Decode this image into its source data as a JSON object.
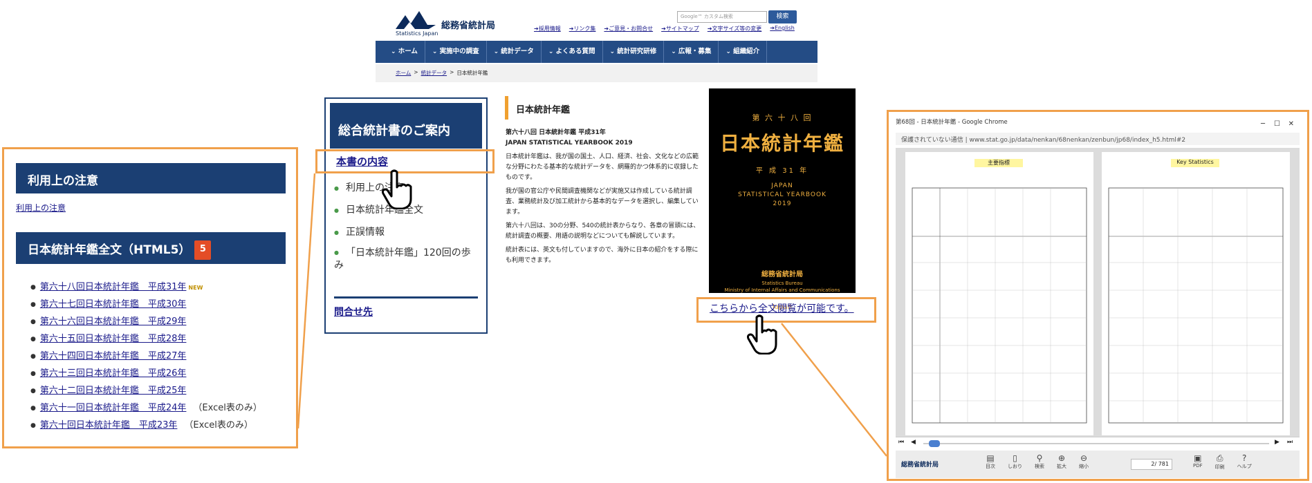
{
  "site": {
    "logo_jp": "総務省統計局",
    "logo_en": "Statistics Japan",
    "search_placeholder": "Google™ カスタム検索",
    "search_button": "検索",
    "top_links": [
      "➔採用情報",
      "➔リンク集",
      "➔ご意見・お問合せ",
      "➔サイトマップ",
      "➔文字サイズ等の変更",
      "➔English"
    ],
    "nav": [
      "ホーム",
      "実施中の調査",
      "統計データ",
      "よくある質問",
      "統計研究研修",
      "広報・募集",
      "組織紹介"
    ],
    "breadcrumb": [
      "ホーム",
      "統計データ",
      "日本統計年鑑"
    ]
  },
  "sidebar": {
    "heading": "総合統計書のご案内",
    "toc_link": "本書の内容",
    "items": [
      "利用上の注意",
      "日本統計年鑑全文",
      "正誤情報",
      "「日本統計年鑑」120回の歩み"
    ],
    "contact": "問合せ先"
  },
  "content": {
    "title": "日本統計年鑑",
    "subtitle_jp": "第六十八回 日本統計年鑑 平成31年",
    "subtitle_en": "JAPAN STATISTICAL YEARBOOK 2019",
    "para1": "日本統計年鑑は、我が国の国土、人口、経済、社会、文化などの広範な分野にわたる基本的な統計データを、網羅的かつ体系的に収録したものです。",
    "para2": "我が国の官公庁や民間調査機関などが実施又は作成している統計調査、業務統計及び加工統計から基本的なデータを選択し、編集しています。",
    "para3": "第六十八回は、30の分野、540の統計表からなり、各章の冒頭には、統計調査の概要、用語の説明などについても解説しています。",
    "para4": "統計表には、英文も付していますので、海外に日本の紹介をする際にも利用できます。"
  },
  "cover": {
    "edition": "第 六 十 八 回",
    "title": "日本統計年鑑",
    "year": "平 成 31 年",
    "en1": "JAPAN",
    "en2": "STATISTICAL YEARBOOK",
    "en3": "2019",
    "bureau_jp": "総務省統計局",
    "bureau_en": "Statistics Bureau",
    "ministry_en": "Ministry of Internal Affairs and Communications",
    "country": "Japan"
  },
  "full_text_link": "こちらから全文閲覧が可能です。",
  "left_panel": {
    "notes_heading": "利用上の注意",
    "notes_link": "利用上の注意",
    "full_heading": "日本統計年鑑全文（HTML5）",
    "html5_badge": "5",
    "editions": [
      {
        "label": "第六十八回日本統計年鑑　平成31年",
        "suffix": "",
        "new": "NEW"
      },
      {
        "label": "第六十七回日本統計年鑑　平成30年",
        "suffix": "",
        "new": ""
      },
      {
        "label": "第六十六回日本統計年鑑　平成29年",
        "suffix": "",
        "new": ""
      },
      {
        "label": "第六十五回日本統計年鑑　平成28年",
        "suffix": "",
        "new": ""
      },
      {
        "label": "第六十四回日本統計年鑑　平成27年",
        "suffix": "",
        "new": ""
      },
      {
        "label": "第六十三回日本統計年鑑　平成26年",
        "suffix": "",
        "new": ""
      },
      {
        "label": "第六十二回日本統計年鑑　平成25年",
        "suffix": "",
        "new": ""
      },
      {
        "label": "第六十一回日本統計年鑑　平成24年",
        "suffix": "（Excel表のみ）",
        "new": ""
      },
      {
        "label": "第六十回日本統計年鑑　平成23年",
        "suffix": "（Excel表のみ）",
        "new": ""
      }
    ]
  },
  "viewer": {
    "window_title": "第68回 - 日本統計年鑑 - Google Chrome",
    "address": "保護されていない通信 | www.stat.go.jp/data/nenkan/68nenkan/zenbun/jp68/index_h5.html#2",
    "left_heading": "主要指標",
    "right_heading": "Key Statistics",
    "page_counter": "2/ 781",
    "bottom_logo": "総務省統計局",
    "toolbar": [
      "目次",
      "しおり",
      "検索",
      "拡大",
      "縮小",
      "PDF",
      "印刷",
      "ヘルプ"
    ]
  }
}
